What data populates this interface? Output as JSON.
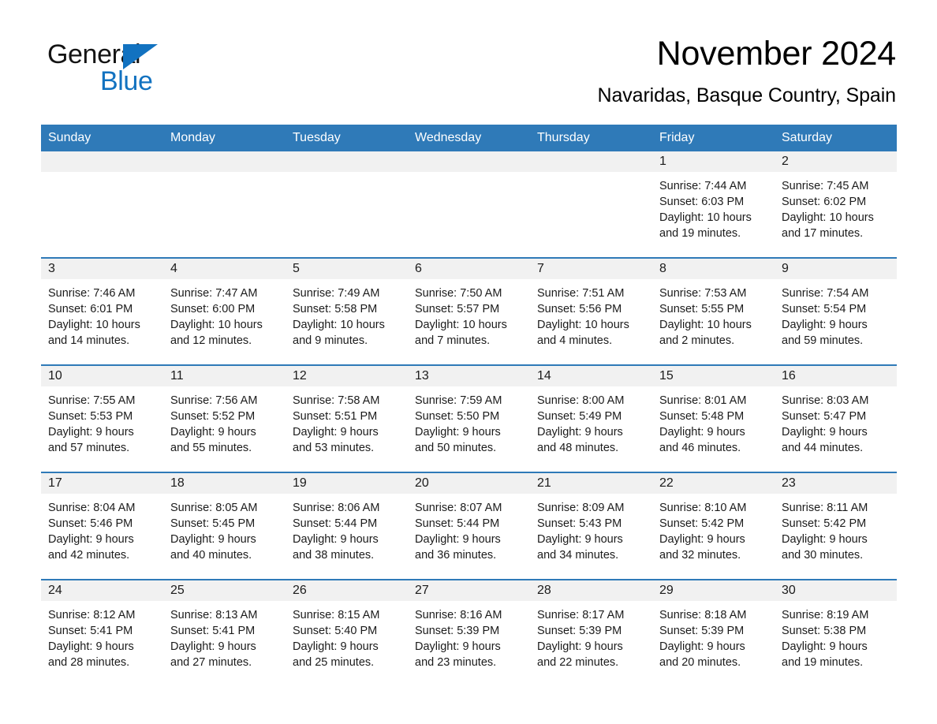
{
  "brand": {
    "name_part1": "General",
    "name_part2": "Blue",
    "triangle_color": "#1272c0",
    "logo_icon": "general-blue-triangle-icon"
  },
  "header": {
    "month_title": "November 2024",
    "location": "Navaridas, Basque Country, Spain"
  },
  "theme": {
    "header_bar_color": "#2f7ab8",
    "day_band_color": "#f1f1f1",
    "row_divider_color": "#2f7ab8",
    "text_color": "#1b1b1b"
  },
  "calendar": {
    "weekdays": [
      "Sunday",
      "Monday",
      "Tuesday",
      "Wednesday",
      "Thursday",
      "Friday",
      "Saturday"
    ],
    "weeks": [
      [
        {
          "day": "",
          "empty": true
        },
        {
          "day": "",
          "empty": true
        },
        {
          "day": "",
          "empty": true
        },
        {
          "day": "",
          "empty": true
        },
        {
          "day": "",
          "empty": true
        },
        {
          "day": "1",
          "sunrise": "Sunrise: 7:44 AM",
          "sunset": "Sunset: 6:03 PM",
          "daylight_line1": "Daylight: 10 hours",
          "daylight_line2": "and 19 minutes."
        },
        {
          "day": "2",
          "sunrise": "Sunrise: 7:45 AM",
          "sunset": "Sunset: 6:02 PM",
          "daylight_line1": "Daylight: 10 hours",
          "daylight_line2": "and 17 minutes."
        }
      ],
      [
        {
          "day": "3",
          "sunrise": "Sunrise: 7:46 AM",
          "sunset": "Sunset: 6:01 PM",
          "daylight_line1": "Daylight: 10 hours",
          "daylight_line2": "and 14 minutes."
        },
        {
          "day": "4",
          "sunrise": "Sunrise: 7:47 AM",
          "sunset": "Sunset: 6:00 PM",
          "daylight_line1": "Daylight: 10 hours",
          "daylight_line2": "and 12 minutes."
        },
        {
          "day": "5",
          "sunrise": "Sunrise: 7:49 AM",
          "sunset": "Sunset: 5:58 PM",
          "daylight_line1": "Daylight: 10 hours",
          "daylight_line2": "and 9 minutes."
        },
        {
          "day": "6",
          "sunrise": "Sunrise: 7:50 AM",
          "sunset": "Sunset: 5:57 PM",
          "daylight_line1": "Daylight: 10 hours",
          "daylight_line2": "and 7 minutes."
        },
        {
          "day": "7",
          "sunrise": "Sunrise: 7:51 AM",
          "sunset": "Sunset: 5:56 PM",
          "daylight_line1": "Daylight: 10 hours",
          "daylight_line2": "and 4 minutes."
        },
        {
          "day": "8",
          "sunrise": "Sunrise: 7:53 AM",
          "sunset": "Sunset: 5:55 PM",
          "daylight_line1": "Daylight: 10 hours",
          "daylight_line2": "and 2 minutes."
        },
        {
          "day": "9",
          "sunrise": "Sunrise: 7:54 AM",
          "sunset": "Sunset: 5:54 PM",
          "daylight_line1": "Daylight: 9 hours",
          "daylight_line2": "and 59 minutes."
        }
      ],
      [
        {
          "day": "10",
          "sunrise": "Sunrise: 7:55 AM",
          "sunset": "Sunset: 5:53 PM",
          "daylight_line1": "Daylight: 9 hours",
          "daylight_line2": "and 57 minutes."
        },
        {
          "day": "11",
          "sunrise": "Sunrise: 7:56 AM",
          "sunset": "Sunset: 5:52 PM",
          "daylight_line1": "Daylight: 9 hours",
          "daylight_line2": "and 55 minutes."
        },
        {
          "day": "12",
          "sunrise": "Sunrise: 7:58 AM",
          "sunset": "Sunset: 5:51 PM",
          "daylight_line1": "Daylight: 9 hours",
          "daylight_line2": "and 53 minutes."
        },
        {
          "day": "13",
          "sunrise": "Sunrise: 7:59 AM",
          "sunset": "Sunset: 5:50 PM",
          "daylight_line1": "Daylight: 9 hours",
          "daylight_line2": "and 50 minutes."
        },
        {
          "day": "14",
          "sunrise": "Sunrise: 8:00 AM",
          "sunset": "Sunset: 5:49 PM",
          "daylight_line1": "Daylight: 9 hours",
          "daylight_line2": "and 48 minutes."
        },
        {
          "day": "15",
          "sunrise": "Sunrise: 8:01 AM",
          "sunset": "Sunset: 5:48 PM",
          "daylight_line1": "Daylight: 9 hours",
          "daylight_line2": "and 46 minutes."
        },
        {
          "day": "16",
          "sunrise": "Sunrise: 8:03 AM",
          "sunset": "Sunset: 5:47 PM",
          "daylight_line1": "Daylight: 9 hours",
          "daylight_line2": "and 44 minutes."
        }
      ],
      [
        {
          "day": "17",
          "sunrise": "Sunrise: 8:04 AM",
          "sunset": "Sunset: 5:46 PM",
          "daylight_line1": "Daylight: 9 hours",
          "daylight_line2": "and 42 minutes."
        },
        {
          "day": "18",
          "sunrise": "Sunrise: 8:05 AM",
          "sunset": "Sunset: 5:45 PM",
          "daylight_line1": "Daylight: 9 hours",
          "daylight_line2": "and 40 minutes."
        },
        {
          "day": "19",
          "sunrise": "Sunrise: 8:06 AM",
          "sunset": "Sunset: 5:44 PM",
          "daylight_line1": "Daylight: 9 hours",
          "daylight_line2": "and 38 minutes."
        },
        {
          "day": "20",
          "sunrise": "Sunrise: 8:07 AM",
          "sunset": "Sunset: 5:44 PM",
          "daylight_line1": "Daylight: 9 hours",
          "daylight_line2": "and 36 minutes."
        },
        {
          "day": "21",
          "sunrise": "Sunrise: 8:09 AM",
          "sunset": "Sunset: 5:43 PM",
          "daylight_line1": "Daylight: 9 hours",
          "daylight_line2": "and 34 minutes."
        },
        {
          "day": "22",
          "sunrise": "Sunrise: 8:10 AM",
          "sunset": "Sunset: 5:42 PM",
          "daylight_line1": "Daylight: 9 hours",
          "daylight_line2": "and 32 minutes."
        },
        {
          "day": "23",
          "sunrise": "Sunrise: 8:11 AM",
          "sunset": "Sunset: 5:42 PM",
          "daylight_line1": "Daylight: 9 hours",
          "daylight_line2": "and 30 minutes."
        }
      ],
      [
        {
          "day": "24",
          "sunrise": "Sunrise: 8:12 AM",
          "sunset": "Sunset: 5:41 PM",
          "daylight_line1": "Daylight: 9 hours",
          "daylight_line2": "and 28 minutes."
        },
        {
          "day": "25",
          "sunrise": "Sunrise: 8:13 AM",
          "sunset": "Sunset: 5:41 PM",
          "daylight_line1": "Daylight: 9 hours",
          "daylight_line2": "and 27 minutes."
        },
        {
          "day": "26",
          "sunrise": "Sunrise: 8:15 AM",
          "sunset": "Sunset: 5:40 PM",
          "daylight_line1": "Daylight: 9 hours",
          "daylight_line2": "and 25 minutes."
        },
        {
          "day": "27",
          "sunrise": "Sunrise: 8:16 AM",
          "sunset": "Sunset: 5:39 PM",
          "daylight_line1": "Daylight: 9 hours",
          "daylight_line2": "and 23 minutes."
        },
        {
          "day": "28",
          "sunrise": "Sunrise: 8:17 AM",
          "sunset": "Sunset: 5:39 PM",
          "daylight_line1": "Daylight: 9 hours",
          "daylight_line2": "and 22 minutes."
        },
        {
          "day": "29",
          "sunrise": "Sunrise: 8:18 AM",
          "sunset": "Sunset: 5:39 PM",
          "daylight_line1": "Daylight: 9 hours",
          "daylight_line2": "and 20 minutes."
        },
        {
          "day": "30",
          "sunrise": "Sunrise: 8:19 AM",
          "sunset": "Sunset: 5:38 PM",
          "daylight_line1": "Daylight: 9 hours",
          "daylight_line2": "and 19 minutes."
        }
      ]
    ]
  }
}
